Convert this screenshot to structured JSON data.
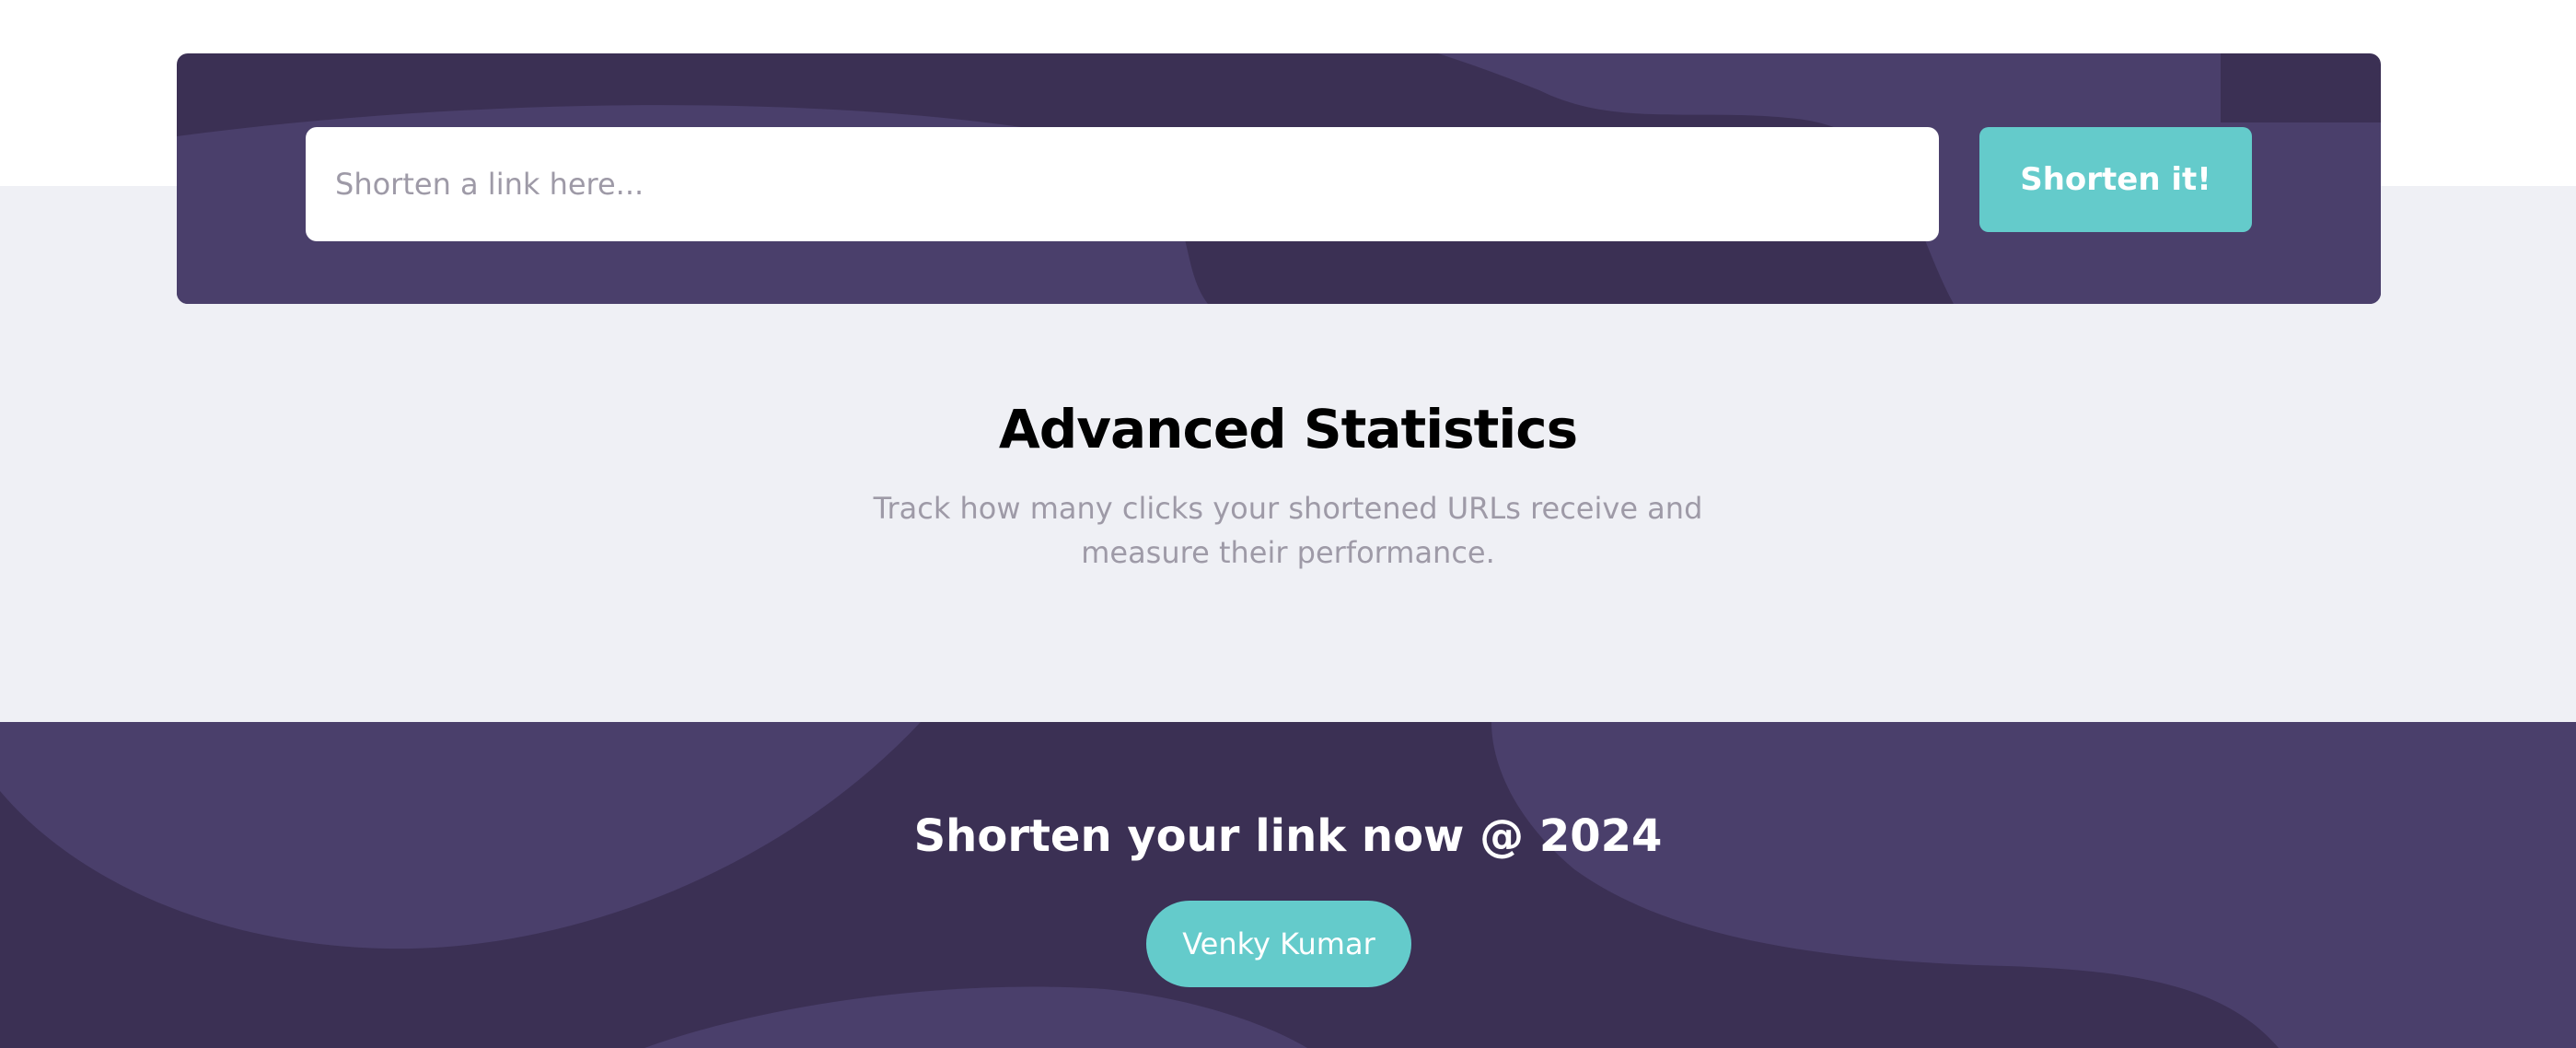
{
  "shorten_form": {
    "input_placeholder": "Shorten a link here...",
    "input_value": "",
    "button_label": "Shorten it!"
  },
  "statistics": {
    "title": "Advanced Statistics",
    "description_line1": "Track how many clicks your shortened URLs receive and",
    "description_line2": "measure their performance."
  },
  "boost": {
    "title": "Shorten your link now @ 2024",
    "author_button_label": "Venky Kumar"
  },
  "colors": {
    "dark_violet": "#3b3054",
    "light_violet_shape": "#4a3f6b",
    "cyan": "#64cbcb",
    "page_background": "#eff0f5",
    "gray_text": "#9e9aa7"
  }
}
